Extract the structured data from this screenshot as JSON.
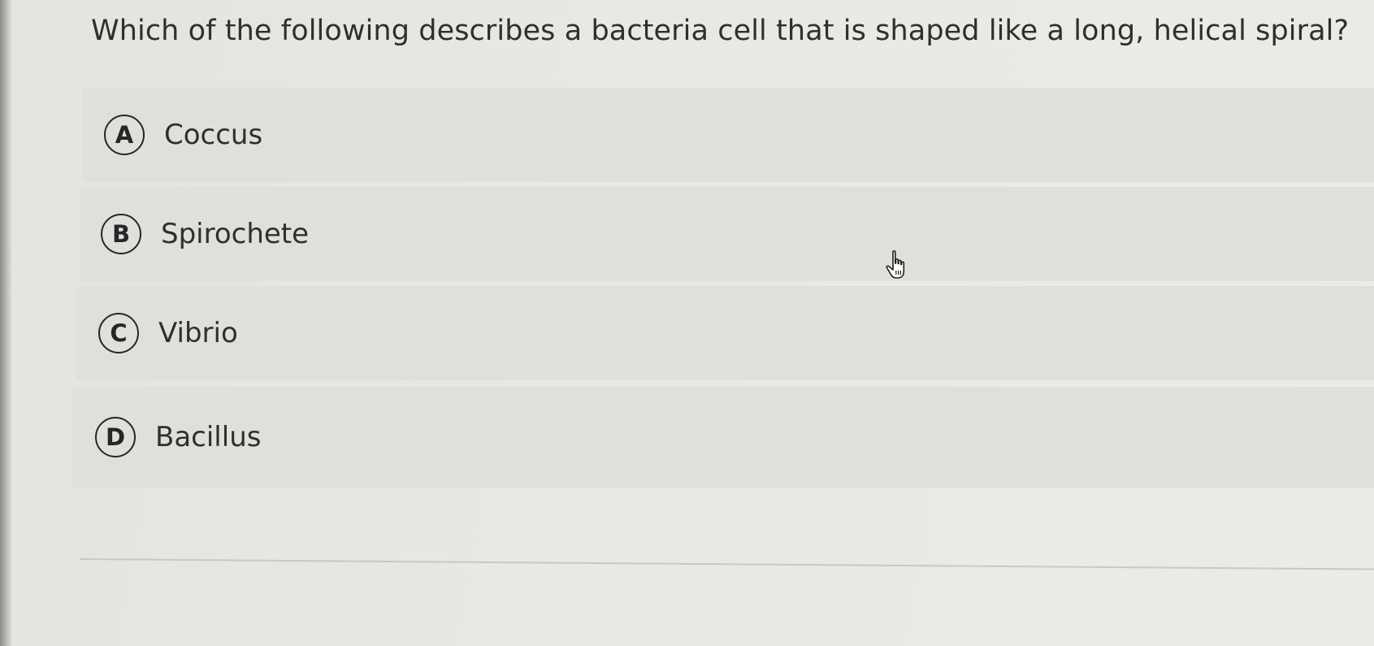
{
  "question": {
    "text": "Which of the following describes a bacteria cell that is shaped like a long, helical spiral?"
  },
  "options": [
    {
      "letter": "A",
      "label": "Coccus"
    },
    {
      "letter": "B",
      "label": "Spirochete"
    },
    {
      "letter": "C",
      "label": "Vibrio"
    },
    {
      "letter": "D",
      "label": "Bacillus"
    }
  ],
  "colors": {
    "background": "#e9e8e4",
    "option_background": "#e0dfdb",
    "text": "#2f2f2f",
    "circle_border": "#262626"
  },
  "icons": {
    "cursor": "hand-pointer-icon"
  }
}
